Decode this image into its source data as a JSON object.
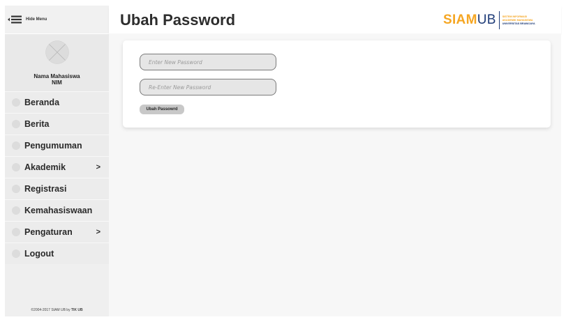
{
  "sidebar": {
    "hide_menu_label": "Hide Menu",
    "profile": {
      "name": "Nama Mahasiswa",
      "nim": "NIM"
    },
    "items": [
      {
        "label": "Beranda",
        "has_submenu": false
      },
      {
        "label": "Berita",
        "has_submenu": false
      },
      {
        "label": "Pengumuman",
        "has_submenu": false
      },
      {
        "label": "Akademik",
        "has_submenu": true
      },
      {
        "label": "Registrasi",
        "has_submenu": false
      },
      {
        "label": "Kemahasiswaan",
        "has_submenu": false
      },
      {
        "label": "Pengaturan",
        "has_submenu": true
      },
      {
        "label": "Logout",
        "has_submenu": false
      }
    ],
    "chevron": ">",
    "copyright_text": "©2004-2017 SIAM UB by ",
    "copyright_brand": "TIK UB"
  },
  "header": {
    "title": "Ubah Password",
    "logo": {
      "siam": "SIAM",
      "ub": "UB",
      "line1": "SISTEM INFORMASI",
      "line2": "AKADEMIK MAHASISWA",
      "line3": "UNIVERSITAS BRAWIJAYA"
    }
  },
  "form": {
    "new_password_placeholder": "Enter New Password",
    "new_password_value": "",
    "reenter_password_placeholder": "Re-Enter New Password",
    "reenter_password_value": "",
    "submit_label": "Ubah Passowrd"
  },
  "colors": {
    "brand_orange": "#f5a623",
    "brand_blue": "#1f3c78",
    "sidebar_bg": "#efefef",
    "main_bg": "#f7f7f7"
  },
  "icons": {
    "hide_menu": "hamburger-arrow-icon",
    "avatar": "avatar-placeholder-icon",
    "nav_bullet": "circle-icon",
    "submenu": "chevron-right-icon"
  }
}
